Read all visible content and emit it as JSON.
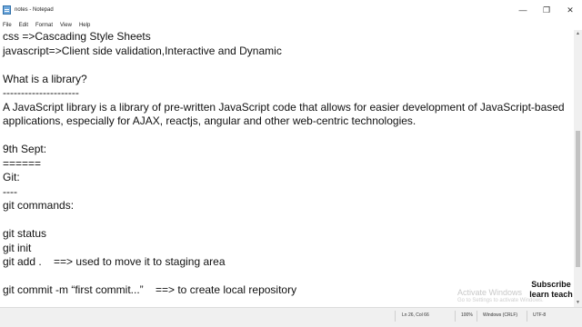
{
  "window": {
    "title": "notes - Notepad",
    "controls": [
      "—",
      "❐",
      "✕"
    ]
  },
  "menu": [
    "File",
    "Edit",
    "Format",
    "View",
    "Help"
  ],
  "document": {
    "lines": [
      "css =>Cascading Style Sheets",
      "javascript=>Client side validation,Interactive and Dynamic",
      "",
      "What is a library?",
      "---------------------",
      "A JavaScript library is a library of pre-written JavaScript code that allows for easier development of JavaScript-based",
      "applications, especially for AJAX, reactjs, angular and other web-centric technologies.",
      "",
      "9th Sept:",
      "======",
      "Git:",
      "----",
      "git commands:",
      "",
      "git status",
      "git init",
      "git add .    ==> used to move it to staging area",
      "",
      "git commit -m “first commit...”    ==> to create local repository"
    ]
  },
  "status": {
    "position": "Ln 26, Col 66",
    "zoom": "100%",
    "line_ending": "Windows (CRLF)",
    "encoding": "UTF-8"
  },
  "watermark": {
    "title": "Activate Windows",
    "subtitle": "Go to Settings to activate Windows."
  },
  "overlay": {
    "line1": "Subscribe",
    "line2": "learn teach"
  }
}
